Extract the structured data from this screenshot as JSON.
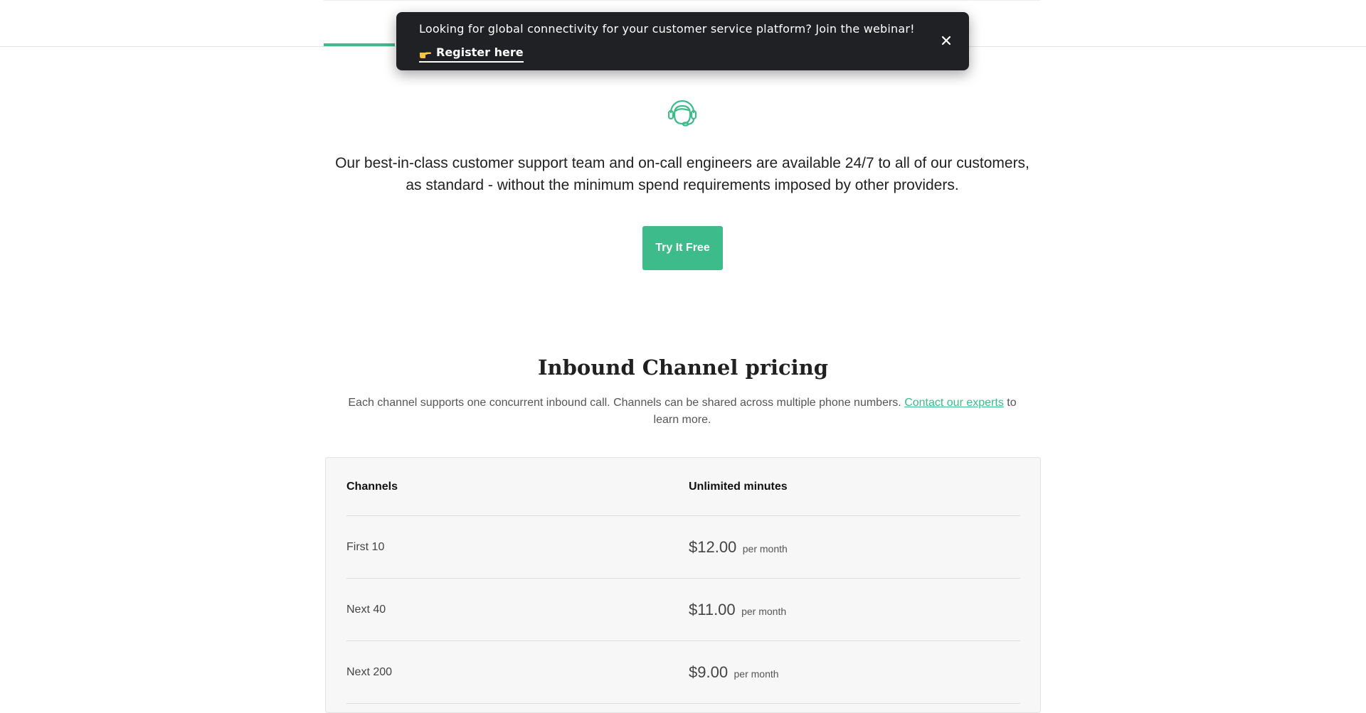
{
  "banner": {
    "message": "Looking for global connectivity for your customer service platform? Join the webinar!",
    "link_label": "Register here",
    "emoji_icon": "pointing-hand-icon",
    "close_icon": "close-icon"
  },
  "hero": {
    "icon": "headset-support-icon",
    "text": "Our best-in-class customer support team and on-call engineers are available 24/7 to all of our customers, as standard - without the minimum spend requirements imposed by other providers.",
    "cta_label": "Try It Free"
  },
  "pricing": {
    "title": "Inbound Channel pricing",
    "description_before": "Each channel supports one concurrent inbound call. Channels can be shared across multiple phone numbers. ",
    "description_link": "Contact our experts",
    "description_after": " to learn more.",
    "headers": [
      "Channels",
      "Unlimited minutes"
    ],
    "rows": [
      {
        "tier": "First 10",
        "price": "$12.00",
        "unit": "per month"
      },
      {
        "tier": "Next 40",
        "price": "$11.00",
        "unit": "per month"
      },
      {
        "tier": "Next 200",
        "price": "$9.00",
        "unit": "per month"
      }
    ]
  },
  "colors": {
    "accent": "#3dbb8a",
    "banner_bg": "#202124"
  }
}
